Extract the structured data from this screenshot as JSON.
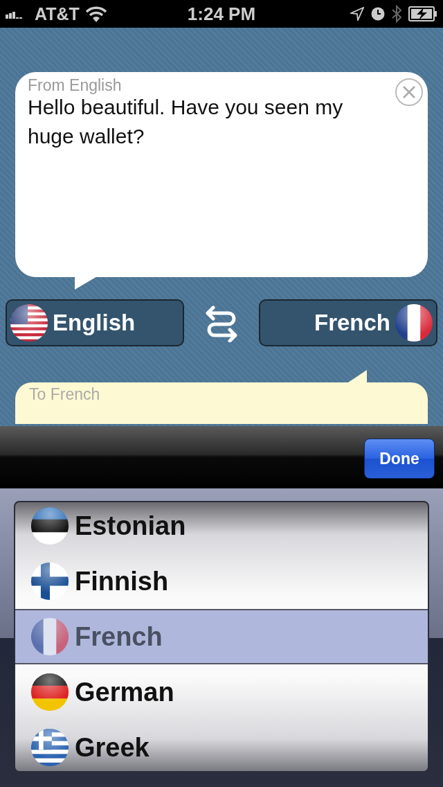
{
  "status_bar": {
    "carrier": "AT&T",
    "time": "1:24 PM"
  },
  "source": {
    "label": "From English",
    "text": "Hello beautiful. Have you seen my huge wallet?"
  },
  "from_language": {
    "name": "English",
    "kind": "us"
  },
  "to_language": {
    "name": "French",
    "kind": "fr"
  },
  "target": {
    "label": "To French"
  },
  "toolbar": {
    "done": "Done"
  },
  "picker": [
    {
      "name": "Estonian",
      "kind": "ee",
      "selected": false
    },
    {
      "name": "Finnish",
      "kind": "fi",
      "selected": false
    },
    {
      "name": "French",
      "kind": "fr",
      "selected": true
    },
    {
      "name": "German",
      "kind": "de",
      "selected": false
    },
    {
      "name": "Greek",
      "kind": "gr",
      "selected": false
    }
  ]
}
